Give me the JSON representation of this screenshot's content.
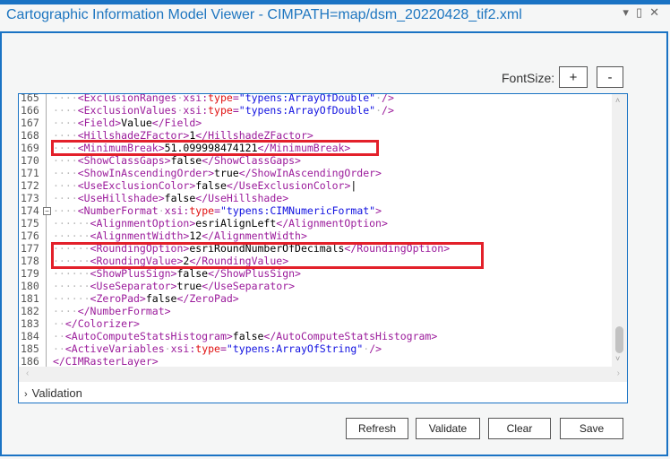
{
  "window": {
    "title": "Cartographic Information Model Viewer - CIMPATH=map/dsm_20220428_tif2.xml",
    "icons": [
      "dropdown-icon",
      "maximize-icon",
      "close-icon"
    ]
  },
  "font_size": {
    "label": "FontSize:",
    "increase": "+",
    "decrease": "-"
  },
  "code_lines": [
    {
      "n": "165",
      "d": 4,
      "t": [
        [
          "tag",
          "<ExclusionRanges"
        ],
        [
          "dot",
          "·"
        ],
        [
          "an",
          "xsi:"
        ],
        [
          "ty",
          "type"
        ],
        [
          "tag",
          "="
        ],
        [
          "val",
          "\"typens:ArrayOfDouble\""
        ],
        [
          "dot",
          "·"
        ],
        [
          "tag",
          "/>"
        ]
      ]
    },
    {
      "n": "166",
      "d": 4,
      "t": [
        [
          "tag",
          "<ExclusionValues"
        ],
        [
          "dot",
          "·"
        ],
        [
          "an",
          "xsi:"
        ],
        [
          "ty",
          "type"
        ],
        [
          "tag",
          "="
        ],
        [
          "val",
          "\"typens:ArrayOfDouble\""
        ],
        [
          "dot",
          "·"
        ],
        [
          "tag",
          "/>"
        ]
      ]
    },
    {
      "n": "167",
      "d": 4,
      "t": [
        [
          "tag",
          "<Field>"
        ],
        [
          "tx",
          "Value"
        ],
        [
          "tag",
          "</Field>"
        ]
      ]
    },
    {
      "n": "168",
      "d": 4,
      "t": [
        [
          "tag",
          "<HillshadeZFactor>"
        ],
        [
          "tx",
          "1"
        ],
        [
          "tag",
          "</HillshadeZFactor>"
        ]
      ]
    },
    {
      "n": "169",
      "d": 4,
      "t": [
        [
          "tag",
          "<MinimumBreak>"
        ],
        [
          "tx",
          "51.099998474121"
        ],
        [
          "tag",
          "</MinimumBreak>"
        ]
      ]
    },
    {
      "n": "170",
      "d": 4,
      "t": [
        [
          "tag",
          "<ShowClassGaps>"
        ],
        [
          "tx",
          "false"
        ],
        [
          "tag",
          "</ShowClassGaps>"
        ]
      ]
    },
    {
      "n": "171",
      "d": 4,
      "t": [
        [
          "tag",
          "<ShowInAscendingOrder>"
        ],
        [
          "tx",
          "true"
        ],
        [
          "tag",
          "</ShowInAscendingOrder>"
        ]
      ]
    },
    {
      "n": "172",
      "d": 4,
      "t": [
        [
          "tag",
          "<UseExclusionColor>"
        ],
        [
          "tx",
          "false"
        ],
        [
          "tag",
          "</UseExclusionColor>"
        ],
        [
          "tx",
          "|"
        ]
      ]
    },
    {
      "n": "173",
      "d": 4,
      "t": [
        [
          "tag",
          "<UseHillshade>"
        ],
        [
          "tx",
          "false"
        ],
        [
          "tag",
          "</UseHillshade>"
        ]
      ]
    },
    {
      "n": "174",
      "d": 4,
      "t": [
        [
          "tag",
          "<NumberFormat"
        ],
        [
          "dot",
          "·"
        ],
        [
          "an",
          "xsi:"
        ],
        [
          "ty",
          "type"
        ],
        [
          "tag",
          "="
        ],
        [
          "val",
          "\"typens:CIMNumericFormat\""
        ],
        [
          "tag",
          ">"
        ]
      ]
    },
    {
      "n": "175",
      "d": 6,
      "t": [
        [
          "tag",
          "<AlignmentOption>"
        ],
        [
          "tx",
          "esriAlignLeft"
        ],
        [
          "tag",
          "</AlignmentOption>"
        ]
      ]
    },
    {
      "n": "176",
      "d": 6,
      "t": [
        [
          "tag",
          "<AlignmentWidth>"
        ],
        [
          "tx",
          "12"
        ],
        [
          "tag",
          "</AlignmentWidth>"
        ]
      ]
    },
    {
      "n": "177",
      "d": 6,
      "t": [
        [
          "tag",
          "<RoundingOption>"
        ],
        [
          "tx",
          "esriRoundNumberOfDecimals"
        ],
        [
          "tag",
          "</RoundingOption>"
        ]
      ]
    },
    {
      "n": "178",
      "d": 6,
      "t": [
        [
          "tag",
          "<RoundingValue>"
        ],
        [
          "tx",
          "2"
        ],
        [
          "tag",
          "</RoundingValue>"
        ]
      ]
    },
    {
      "n": "179",
      "d": 6,
      "t": [
        [
          "tag",
          "<ShowPlusSign>"
        ],
        [
          "tx",
          "false"
        ],
        [
          "tag",
          "</ShowPlusSign>"
        ]
      ]
    },
    {
      "n": "180",
      "d": 6,
      "t": [
        [
          "tag",
          "<UseSeparator>"
        ],
        [
          "tx",
          "true"
        ],
        [
          "tag",
          "</UseSeparator>"
        ]
      ]
    },
    {
      "n": "181",
      "d": 6,
      "t": [
        [
          "tag",
          "<ZeroPad>"
        ],
        [
          "tx",
          "false"
        ],
        [
          "tag",
          "</ZeroPad>"
        ]
      ]
    },
    {
      "n": "182",
      "d": 4,
      "t": [
        [
          "tag",
          "</NumberFormat>"
        ]
      ]
    },
    {
      "n": "183",
      "d": 2,
      "t": [
        [
          "tag",
          "</Colorizer>"
        ]
      ]
    },
    {
      "n": "184",
      "d": 2,
      "t": [
        [
          "tag",
          "<AutoComputeStatsHistogram>"
        ],
        [
          "tx",
          "false"
        ],
        [
          "tag",
          "</AutoComputeStatsHistogram>"
        ]
      ]
    },
    {
      "n": "185",
      "d": 2,
      "t": [
        [
          "tag",
          "<ActiveVariables"
        ],
        [
          "dot",
          "·"
        ],
        [
          "an",
          "xsi:"
        ],
        [
          "ty",
          "type"
        ],
        [
          "tag",
          "="
        ],
        [
          "val",
          "\"typens:ArrayOfString\""
        ],
        [
          "dot",
          "·"
        ],
        [
          "tag",
          "/>"
        ]
      ]
    },
    {
      "n": "186",
      "d": 0,
      "t": [
        [
          "tag",
          "</CIMRasterLayer>"
        ]
      ]
    }
  ],
  "validation": {
    "label": "Validation"
  },
  "buttons": {
    "refresh": "Refresh",
    "validate": "Validate",
    "clear": "Clear",
    "save": "Save"
  },
  "colors": {
    "accent": "#1a73c4",
    "highlight": "#e3202a"
  }
}
